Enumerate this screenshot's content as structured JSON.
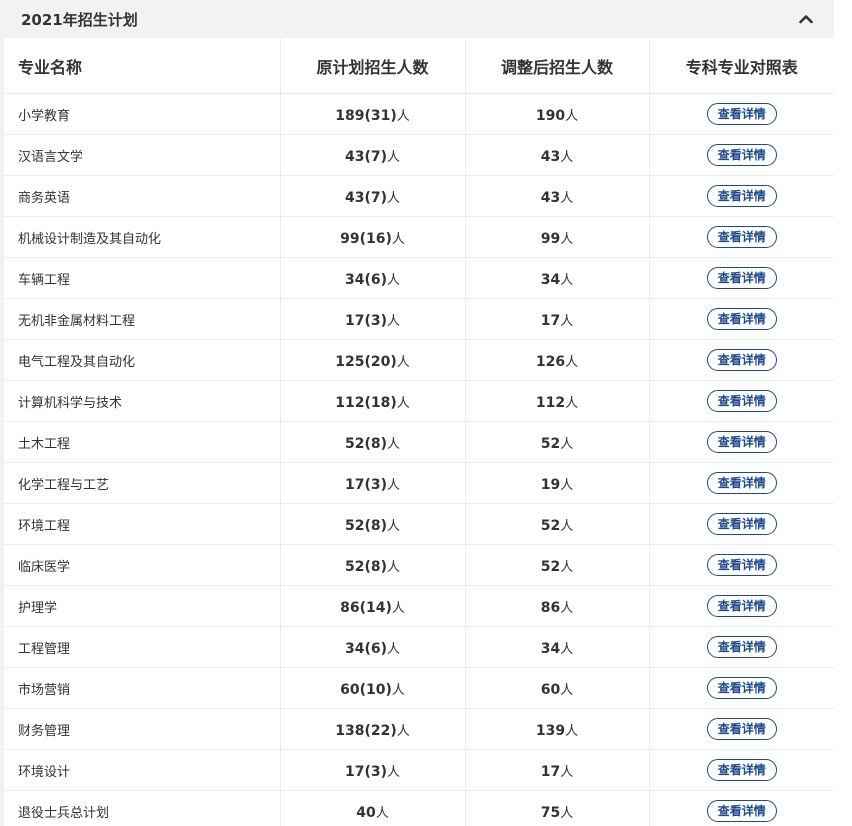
{
  "panel": {
    "title": "2021年招生计划"
  },
  "table": {
    "headers": [
      "专业名称",
      "原计划招生人数",
      "调整后招生人数",
      "专科专业对照表"
    ],
    "unit": "人",
    "detail_label": "查看详情",
    "rows": [
      {
        "major": "小学教育",
        "original": "189(31)",
        "adjusted": "190"
      },
      {
        "major": "汉语言文学",
        "original": "43(7)",
        "adjusted": "43"
      },
      {
        "major": "商务英语",
        "original": "43(7)",
        "adjusted": "43"
      },
      {
        "major": "机械设计制造及其自动化",
        "original": "99(16)",
        "adjusted": "99"
      },
      {
        "major": "车辆工程",
        "original": "34(6)",
        "adjusted": "34"
      },
      {
        "major": "无机非金属材料工程",
        "original": "17(3)",
        "adjusted": "17"
      },
      {
        "major": "电气工程及其自动化",
        "original": "125(20)",
        "adjusted": "126"
      },
      {
        "major": "计算机科学与技术",
        "original": "112(18)",
        "adjusted": "112"
      },
      {
        "major": "土木工程",
        "original": "52(8)",
        "adjusted": "52"
      },
      {
        "major": "化学工程与工艺",
        "original": "17(3)",
        "adjusted": "19"
      },
      {
        "major": "环境工程",
        "original": "52(8)",
        "adjusted": "52"
      },
      {
        "major": "临床医学",
        "original": "52(8)",
        "adjusted": "52"
      },
      {
        "major": "护理学",
        "original": "86(14)",
        "adjusted": "86"
      },
      {
        "major": "工程管理",
        "original": "34(6)",
        "adjusted": "34"
      },
      {
        "major": "市场营销",
        "original": "60(10)",
        "adjusted": "60"
      },
      {
        "major": "财务管理",
        "original": "138(22)",
        "adjusted": "139"
      },
      {
        "major": "环境设计",
        "original": "17(3)",
        "adjusted": "17"
      },
      {
        "major": "退役士兵总计划",
        "original": "40",
        "adjusted": "75"
      }
    ]
  },
  "colors": {
    "accent": "#1e4a8c",
    "panel_bg": "#f2f2f2"
  },
  "icons": {
    "collapse": "chevron-up-icon"
  }
}
